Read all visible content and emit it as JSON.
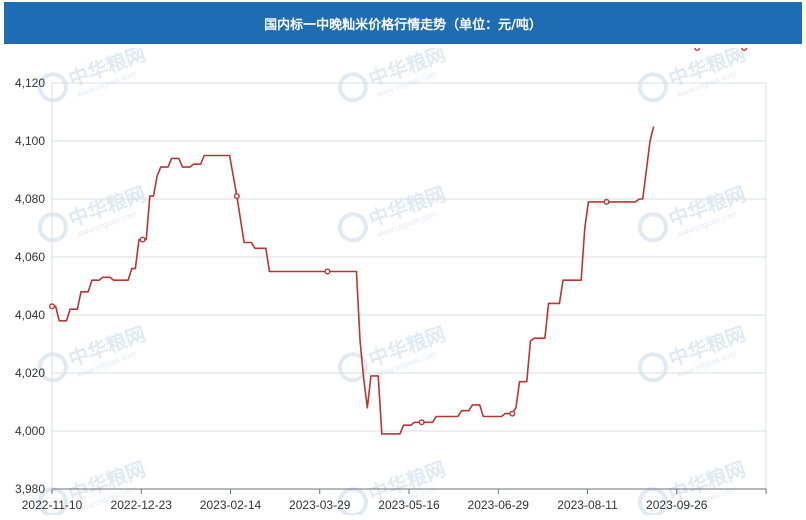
{
  "chart_data": {
    "type": "line",
    "title": "国内标一中晚籼米价格行情走势（单位：元/吨）",
    "x_ticks": [
      "2022-11-10",
      "2022-12-23",
      "2023-02-14",
      "2023-03-29",
      "2023-05-16",
      "2023-06-29",
      "2023-08-11",
      "2023-09-26"
    ],
    "y_ticks": [
      3980,
      4000,
      4020,
      4040,
      4060,
      4080,
      4100,
      4120
    ],
    "ylim": [
      3980,
      4120
    ],
    "grid": true,
    "legend": "none",
    "series": [
      {
        "values": [
          4043,
          4043,
          4038,
          4038,
          4038,
          4042,
          4042,
          4042,
          4048,
          4048,
          4048,
          4052,
          4052,
          4052,
          4053,
          4053,
          4053,
          4052,
          4052,
          4052,
          4052,
          4052,
          4056,
          4056,
          4066,
          4066,
          4066,
          4081,
          4081,
          4088,
          4091,
          4091,
          4091,
          4094,
          4094,
          4094,
          4091,
          4091,
          4091,
          4092,
          4092,
          4092,
          4095,
          4095,
          4095,
          4095,
          4095,
          4095,
          4095,
          4095,
          4088,
          4081,
          4073,
          4065,
          4065,
          4065,
          4063,
          4063,
          4063,
          4063,
          4055,
          4055,
          4055,
          4055,
          4055,
          4055,
          4055,
          4055,
          4055,
          4055,
          4055,
          4055,
          4055,
          4055,
          4055,
          4055,
          4055,
          4055,
          4055,
          4055,
          4055,
          4055,
          4055,
          4055,
          4055,
          4031,
          4018,
          4008,
          4019,
          4019,
          4019,
          3999,
          3999,
          3999,
          3999,
          3999,
          3999,
          4002,
          4002,
          4002,
          4003,
          4003,
          4003,
          4003,
          4003,
          4003,
          4005,
          4005,
          4005,
          4005,
          4005,
          4005,
          4005,
          4007,
          4007,
          4007,
          4009,
          4009,
          4009,
          4005,
          4005,
          4005,
          4005,
          4005,
          4005,
          4006,
          4006,
          4006,
          4008,
          4017,
          4017,
          4017,
          4031,
          4032,
          4032,
          4032,
          4032,
          4044,
          4044,
          4044,
          4044,
          4052,
          4052,
          4052,
          4052,
          4052,
          4052,
          4070,
          4079,
          4079,
          4079,
          4079,
          4079,
          4079,
          4079,
          4079,
          4079,
          4079,
          4079,
          4079,
          4079,
          4079,
          4080,
          4080,
          4090,
          4100,
          4105
        ],
        "markers": [
          0,
          25,
          51,
          76,
          102,
          127,
          153,
          178,
          191
        ],
        "color": "#b83535"
      }
    ],
    "x_count": 198
  },
  "watermark": {
    "cn": "中华粮网",
    "en": "www.cngrain.com"
  },
  "colors": {
    "title_bg": "#1e6db3",
    "grid": "#d9dde6",
    "axis": "#6e7079",
    "label": "#333333",
    "watermark": "#c9d8ea"
  }
}
